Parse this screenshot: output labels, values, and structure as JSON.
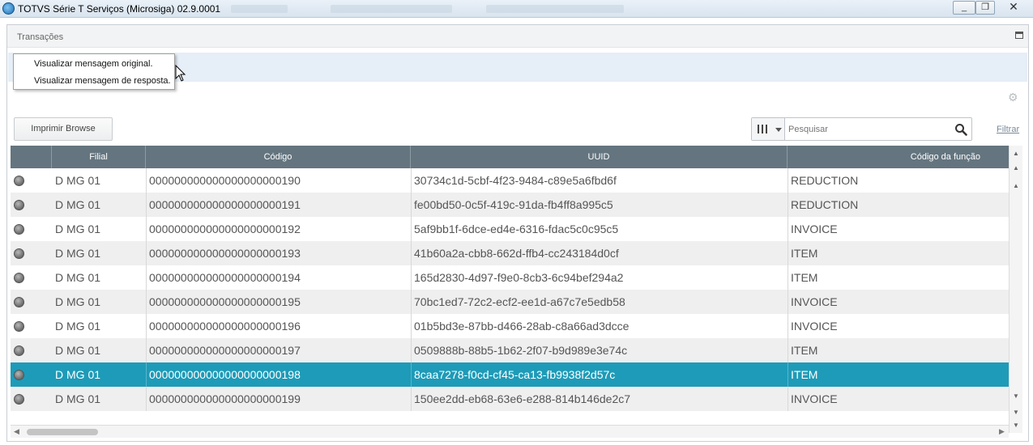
{
  "window": {
    "title": "TOTVS Série T Serviços (Microsiga) 02.9.0001",
    "controls": {
      "minimize": "_",
      "restore": "❐",
      "close": "✕"
    }
  },
  "dialog": {
    "title": "Transações"
  },
  "context_menu": {
    "items": [
      {
        "label": "Visualizar mensagem original."
      },
      {
        "label": "Visualizar mensagem de resposta."
      }
    ]
  },
  "toolbar": {
    "print_label": "Imprimir Browse",
    "search_placeholder": "Pesquisar",
    "filter_label": "Filtrar"
  },
  "icons": {
    "app": "totvs-app-icon",
    "settings": "gear-icon",
    "search": "search-icon",
    "columns": "columns-icon",
    "status": "status-dot-icon"
  },
  "grid": {
    "columns": [
      "",
      "Filial",
      "Código",
      "UUID",
      "Código da função"
    ],
    "rows": [
      {
        "filial": "D MG 01",
        "codigo": "000000000000000000000190",
        "uuid": "30734c1d-5cbf-4f23-9484-c89e5a6fbd6f",
        "funcao": "REDUCTION"
      },
      {
        "filial": "D MG 01",
        "codigo": "000000000000000000000191",
        "uuid": "fe00bd50-0c5f-419c-91da-fb4ff8a995c5",
        "funcao": "REDUCTION"
      },
      {
        "filial": "D MG 01",
        "codigo": "000000000000000000000192",
        "uuid": "5af9bb1f-6dce-ed4e-6316-fdac5c0c95c5",
        "funcao": "INVOICE"
      },
      {
        "filial": "D MG 01",
        "codigo": "000000000000000000000193",
        "uuid": "41b60a2a-cbb8-662d-ffb4-cc243184d0cf",
        "funcao": "ITEM"
      },
      {
        "filial": "D MG 01",
        "codigo": "000000000000000000000194",
        "uuid": "165d2830-4d97-f9e0-8cb3-6c94bef294a2",
        "funcao": "ITEM"
      },
      {
        "filial": "D MG 01",
        "codigo": "000000000000000000000195",
        "uuid": "70bc1ed7-72c2-ecf2-ee1d-a67c7e5edb58",
        "funcao": "INVOICE"
      },
      {
        "filial": "D MG 01",
        "codigo": "000000000000000000000196",
        "uuid": "01b5bd3e-87bb-d466-28ab-c8a66ad3dcce",
        "funcao": "INVOICE"
      },
      {
        "filial": "D MG 01",
        "codigo": "000000000000000000000197",
        "uuid": "0509888b-88b5-1b62-2f07-b9d989e3e74c",
        "funcao": "ITEM"
      },
      {
        "filial": "D MG 01",
        "codigo": "000000000000000000000198",
        "uuid": "8caa7278-f0cd-cf45-ca13-fb9938f2d57c",
        "funcao": "ITEM",
        "selected": true
      },
      {
        "filial": "D MG 01",
        "codigo": "000000000000000000000199",
        "uuid": "150ee2dd-eb68-63e6-e288-814b146de2c7",
        "funcao": "INVOICE"
      }
    ]
  },
  "colors": {
    "header_bg": "#64757f",
    "selected_row_bg": "#1e9bb8",
    "action_bar_bg": "#e6eef7"
  }
}
